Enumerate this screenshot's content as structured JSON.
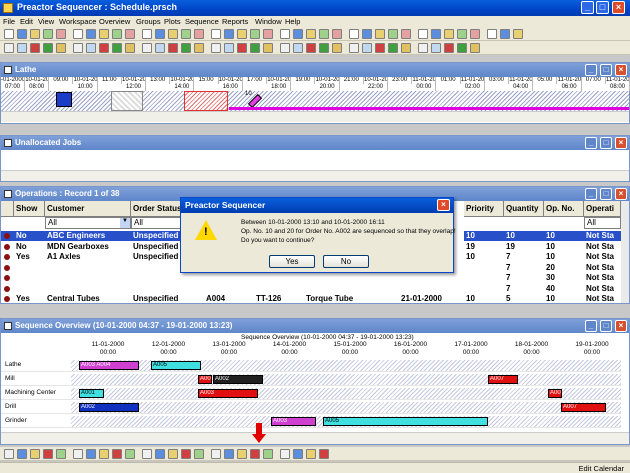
{
  "window": {
    "title": "Preactor Sequencer : Schedule.prsch"
  },
  "menu": [
    "File",
    "Edit",
    "View",
    "Workspace",
    "Overview",
    "Groups",
    "Plots",
    "Sequence",
    "Reports",
    "Window",
    "Help"
  ],
  "lathe": {
    "title": "Lathe",
    "times": [
      {
        "d": "-01-2000",
        "t": "07:00"
      },
      {
        "d": "10-01-2000",
        "t": "08:00"
      },
      {
        "d": "",
        "t": "09:00"
      },
      {
        "d": "10-01-2000",
        "t": "10:00"
      },
      {
        "d": "",
        "t": "11:00"
      },
      {
        "d": "10-01-2000",
        "t": "12:00"
      },
      {
        "d": "",
        "t": "13:00"
      },
      {
        "d": "10-01-2000",
        "t": "14:00"
      },
      {
        "d": "",
        "t": "15:00"
      },
      {
        "d": "10-01-2000",
        "t": "16:00"
      },
      {
        "d": "",
        "t": "17:00"
      },
      {
        "d": "10-01-2000",
        "t": "18:00"
      },
      {
        "d": "",
        "t": "19:00"
      },
      {
        "d": "10-01-2000",
        "t": "20:00"
      },
      {
        "d": "",
        "t": "21:00"
      },
      {
        "d": "10-01-2000",
        "t": "22:00"
      },
      {
        "d": "",
        "t": "23:00"
      },
      {
        "d": "11-01-2000",
        "t": "00:00"
      },
      {
        "d": "",
        "t": "01:00"
      },
      {
        "d": "11-01-2000",
        "t": "02:00"
      },
      {
        "d": "",
        "t": "03:00"
      },
      {
        "d": "11-01-2000",
        "t": "04:00"
      },
      {
        "d": "",
        "t": "05:00"
      },
      {
        "d": "11-01-2000",
        "t": "06:00"
      },
      {
        "d": "",
        "t": "07:00"
      },
      {
        "d": "11-01-2000",
        "t": "08:00"
      }
    ],
    "marker": "10"
  },
  "unallocated": {
    "title": "Unallocated Jobs"
  },
  "operations": {
    "title": "Operations : Record 1 of 38",
    "columns": [
      "Show",
      "Customer",
      "Order Status",
      "Priority",
      "Quantity",
      "Op. No.",
      "Operati"
    ],
    "filters": [
      "All",
      "All",
      "All"
    ],
    "rows": [
      {
        "show": "No",
        "customer": "ABC Engineers",
        "status": "Unspecified",
        "priority": "10",
        "qty": "10",
        "op": "10",
        "opstat": "Not Sta"
      },
      {
        "show": "No",
        "customer": "MDN Gearboxes",
        "status": "Unspecified",
        "priority": "19",
        "qty": "19",
        "op": "10",
        "opstat": "Not Sta"
      },
      {
        "show": "Yes",
        "customer": "A1 Axles",
        "status": "Unspecified",
        "priority": "10",
        "qty": "7",
        "op": "10",
        "opstat": "Not Sta"
      },
      {
        "show": "",
        "customer": "",
        "status": "",
        "priority": "",
        "qty": "7",
        "op": "20",
        "opstat": "Not Sta"
      },
      {
        "show": "",
        "customer": "",
        "status": "",
        "priority": "",
        "qty": "7",
        "op": "30",
        "opstat": "Not Sta"
      },
      {
        "show": "",
        "customer": "",
        "status": "",
        "priority": "",
        "qty": "7",
        "op": "40",
        "opstat": "Not Sta"
      },
      {
        "show": "Yes",
        "customer": "Central Tubes",
        "status": "Unspecified",
        "priority": "10",
        "qty": "5",
        "op": "10",
        "opstat": "Not Sta"
      }
    ],
    "partial_row": {
      "c1": "A004",
      "c2": "TT-126",
      "c3": "Torque Tube",
      "c4": "21-01-2000"
    }
  },
  "dialog": {
    "title": "Preactor Sequencer",
    "line1": "Between 10-01-2000 13:10 and 10-01-2000 16:11",
    "line2": "Op. No. 10 and 20 for Order No. A002 are sequenced so that they overlap!",
    "line3": "Do you want to continue?",
    "yes": "Yes",
    "no": "No"
  },
  "overview": {
    "title": "Sequence Overview   (10-01-2000 04:37 - 19-01-2000 13:23)",
    "header": "Sequence Overview   (10-01-2000 04:37 - 19-01-2000 13:23)",
    "dates": [
      {
        "d": "11-01-2000",
        "t": "00:00"
      },
      {
        "d": "12-01-2000",
        "t": "00:00"
      },
      {
        "d": "13-01-2000",
        "t": "00:00"
      },
      {
        "d": "14-01-2000",
        "t": "00:00"
      },
      {
        "d": "15-01-2000",
        "t": "00:00"
      },
      {
        "d": "16-01-2000",
        "t": "00:00"
      },
      {
        "d": "17-01-2000",
        "t": "00:00"
      },
      {
        "d": "18-01-2000",
        "t": "00:00"
      },
      {
        "d": "19-01-2000",
        "t": "00:00"
      }
    ],
    "resources": [
      "Lathe",
      "Mill",
      "Machining Center",
      "Drill",
      "Grinder"
    ],
    "bars": [
      {
        "row": 0,
        "label": "A003 A004",
        "color": "#d040d0"
      },
      {
        "row": 0,
        "label": "A005",
        "color": "#40e0e0"
      },
      {
        "row": 1,
        "label": "A001",
        "color": "#e01010"
      },
      {
        "row": 1,
        "label": "A002",
        "color": "#202020"
      },
      {
        "row": 1,
        "label": "A007",
        "color": "#e01010"
      },
      {
        "row": 2,
        "label": "A001",
        "color": "#40e0e0"
      },
      {
        "row": 2,
        "label": "A003",
        "color": "#e01010"
      },
      {
        "row": 2,
        "label": "A007",
        "color": "#e01010"
      },
      {
        "row": 3,
        "label": "A002",
        "color": "#1030c0"
      },
      {
        "row": 3,
        "label": "A007",
        "color": "#e01010"
      },
      {
        "row": 4,
        "label": "A003",
        "color": "#d040d0"
      },
      {
        "row": 4,
        "label": "A005",
        "color": "#40e0e0"
      }
    ]
  },
  "status": {
    "text": "Edit Calendar"
  }
}
